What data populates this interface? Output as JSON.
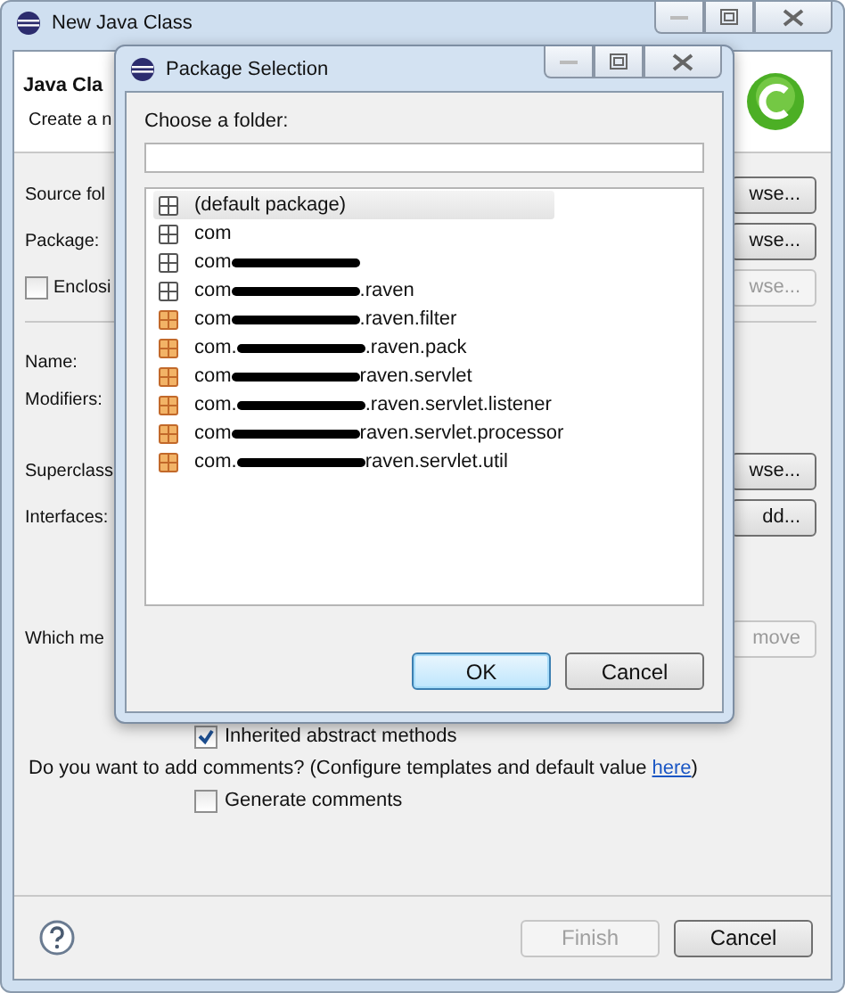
{
  "window": {
    "title": "New Java Class"
  },
  "header": {
    "title": "Java Cla",
    "description": "Create a n"
  },
  "form_rows": [
    {
      "kind": "label",
      "label": "Source fol",
      "button": "wse...",
      "button_disabled": false
    },
    {
      "kind": "label",
      "label": "Package:",
      "button": "wse...",
      "button_disabled": false
    },
    {
      "kind": "checkbox",
      "label": "Enclosi",
      "checked": false,
      "button": "wse...",
      "button_disabled": true
    },
    {
      "kind": "separator"
    },
    {
      "kind": "label",
      "label": "Name:"
    },
    {
      "kind": "label",
      "label": "Modifiers:"
    },
    {
      "kind": "spacer"
    },
    {
      "kind": "label",
      "label": "Superclass",
      "button": "wse...",
      "button_disabled": false
    },
    {
      "kind": "label",
      "label": "Interfaces:",
      "button": "dd...",
      "button_disabled": false
    },
    {
      "kind": "spacer"
    },
    {
      "kind": "label",
      "label": "Which me",
      "button": "move",
      "button_disabled": true
    }
  ],
  "method_options": [
    {
      "label": "Inherited abstract methods",
      "checked": true
    }
  ],
  "comments": {
    "question": "Do you want to add comments? (Configure templates and default value ",
    "link": "here",
    "after": ")",
    "option": {
      "label": "Generate comments",
      "checked": false
    }
  },
  "footer": {
    "buttons": [
      {
        "label": "Finish",
        "disabled": true
      },
      {
        "label": "Cancel",
        "disabled": false
      }
    ]
  },
  "dialog": {
    "title": "Package Selection",
    "prompt": "Choose a folder:",
    "packages": [
      {
        "prefix": "(default package)",
        "redacted": false,
        "has_classes": false,
        "selected": true
      },
      {
        "prefix": "com",
        "redacted": false,
        "has_classes": false,
        "selected": false
      },
      {
        "prefix": "com",
        "redacted": true,
        "has_classes": false,
        "selected": false
      },
      {
        "prefix": "com",
        "redacted": true,
        "suffix": ".raven",
        "has_classes": false,
        "selected": false
      },
      {
        "prefix": "com",
        "redacted": true,
        "suffix": ".raven.filter",
        "has_classes": true,
        "selected": false
      },
      {
        "prefix": "com.",
        "redacted": true,
        "suffix": ".raven.pack",
        "has_classes": true,
        "selected": false
      },
      {
        "prefix": "com",
        "redacted": true,
        "suffix": "raven.servlet",
        "has_classes": true,
        "selected": false
      },
      {
        "prefix": "com.",
        "redacted": true,
        "suffix": ".raven.servlet.listener",
        "has_classes": true,
        "selected": false
      },
      {
        "prefix": "com",
        "redacted": true,
        "suffix": "raven.servlet.processor",
        "has_classes": true,
        "selected": false
      },
      {
        "prefix": "com.",
        "redacted": true,
        "suffix": "raven.servlet.util",
        "has_classes": true,
        "selected": false
      }
    ],
    "buttons": [
      {
        "label": "OK",
        "default": true
      },
      {
        "label": "Cancel",
        "default": false
      }
    ]
  }
}
